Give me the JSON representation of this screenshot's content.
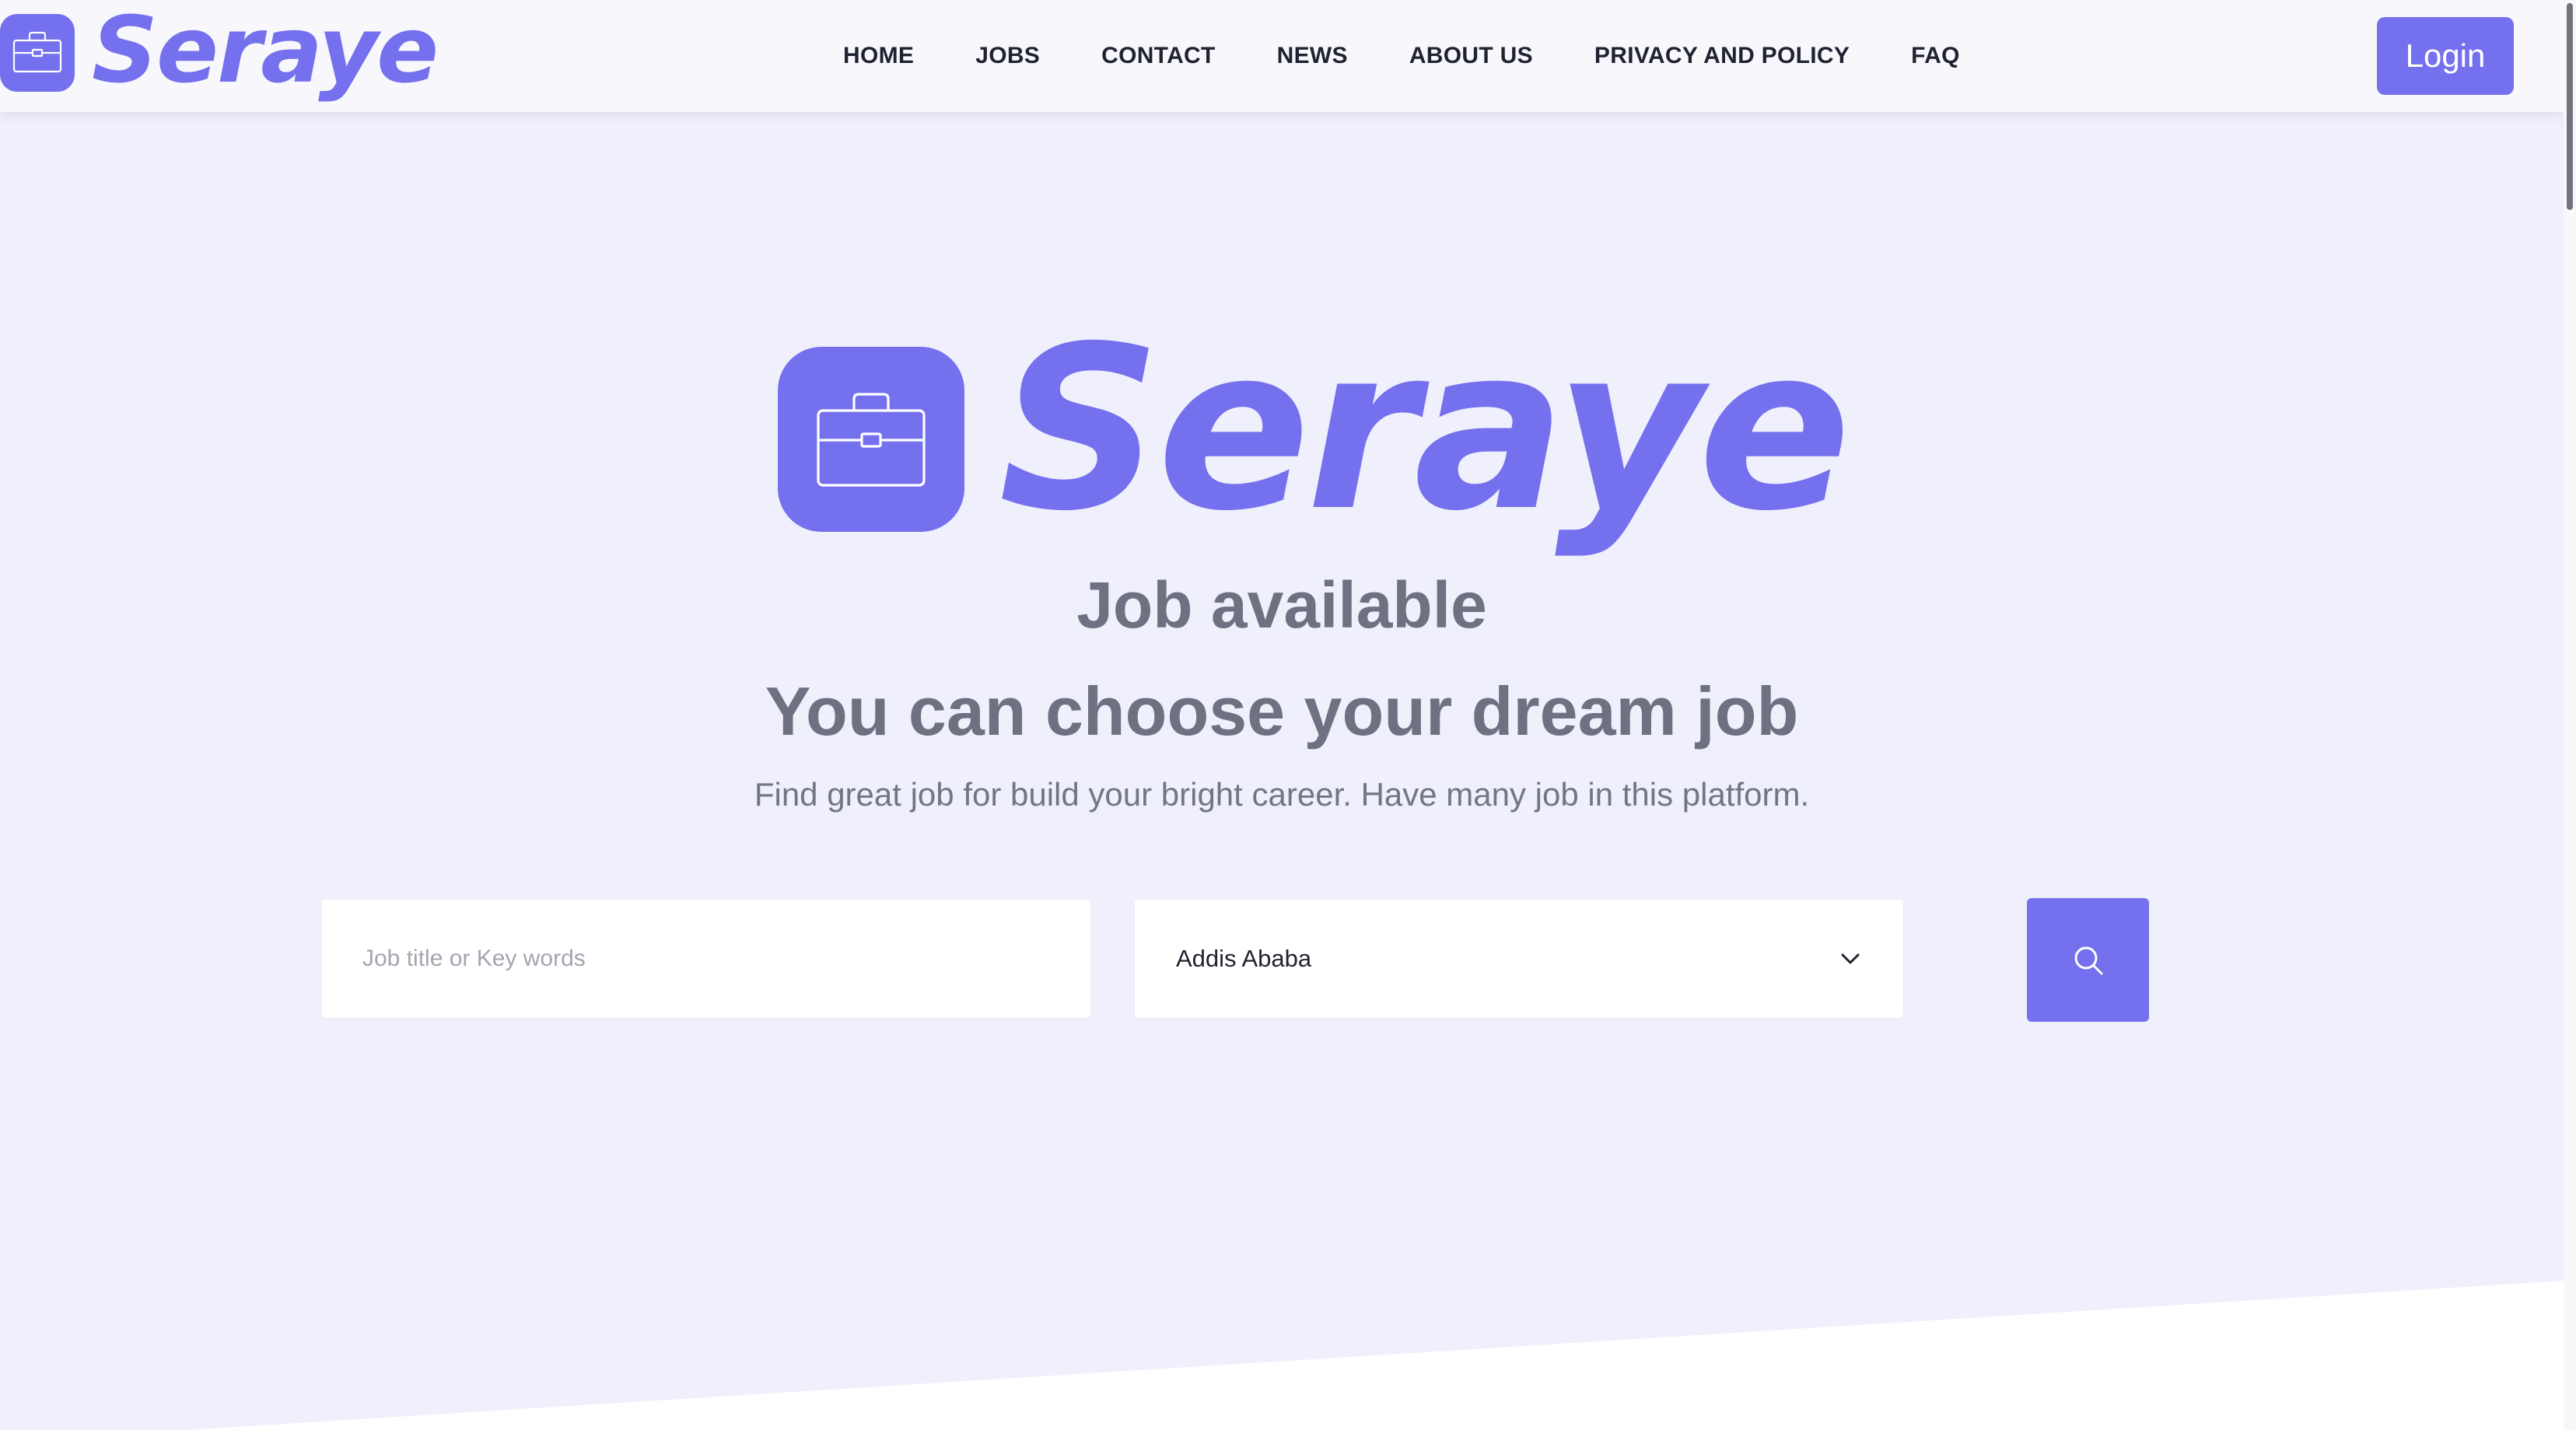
{
  "header": {
    "brand_name": "Seraye",
    "nav": [
      {
        "label": "HOME"
      },
      {
        "label": "JOBS"
      },
      {
        "label": "CONTACT"
      },
      {
        "label": "NEWS"
      },
      {
        "label": "ABOUT US"
      },
      {
        "label": "PRIVACY AND POLICY"
      },
      {
        "label": "FAQ"
      }
    ],
    "login_label": "Login"
  },
  "hero": {
    "brand_name": "Seraye",
    "headline": "Job available",
    "subheadline": "You can choose your dream job",
    "tagline": "Find great job for build your bright career. Have many job in this platform."
  },
  "search": {
    "keyword_placeholder": "Job title or Key words",
    "keyword_value": "",
    "location_value": "Addis Ababa",
    "search_icon": "search-icon"
  },
  "icons": {
    "brand_icon": "briefcase-icon",
    "select_icon": "chevron-down-icon"
  },
  "colors": {
    "accent": "#7571ee",
    "background": "#f0effc",
    "header_bg": "#f8f8fc",
    "heading_text": "#6e7181",
    "nav_text": "#1f2230"
  }
}
